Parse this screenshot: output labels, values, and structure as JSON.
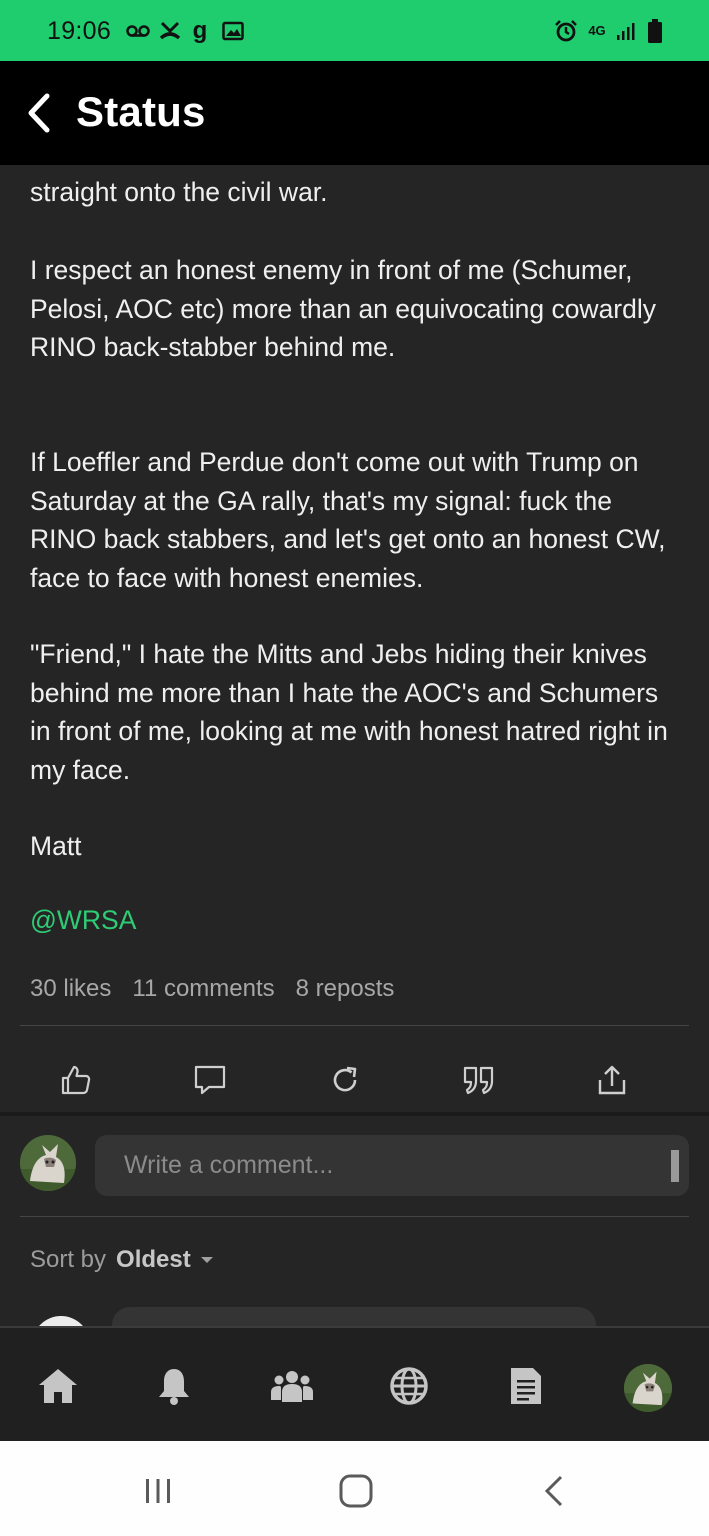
{
  "status_bar": {
    "time": "19:06",
    "notification_icons": [
      "voicemail-icon",
      "missed-call-icon",
      "g-app-icon",
      "gallery-icon"
    ],
    "system_icons": [
      "alarm-icon",
      "4g-lte-icon",
      "signal-icon",
      "battery-icon"
    ],
    "network": "4G"
  },
  "header": {
    "title": "Status"
  },
  "post": {
    "paragraphs": [
      "straight onto the civil war.",
      "I respect an honest enemy in front of me (Schumer, Pelosi, AOC etc) more than an equivocating cowardly RINO back-stabber behind me.",
      "If Loeffler and Perdue don't come out with Trump on Saturday at the GA rally, that's my signal: fuck the RINO back stabbers, and let's get onto an honest CW, face to face with honest enemies.",
      "\"Friend,\" I hate the Mitts and Jebs hiding their knives behind me more than I hate the AOC's and Schumers in front of me, looking at me with honest hatred right in my face.",
      "Matt"
    ],
    "mention": "@WRSA",
    "stats": {
      "likes": "30 likes",
      "comments": "11 comments",
      "reposts": "8 reposts"
    },
    "actions": [
      "like-icon",
      "comment-icon",
      "repost-icon",
      "quote-icon",
      "share-icon"
    ]
  },
  "comment_input": {
    "placeholder": "Write a comment..."
  },
  "sort": {
    "label": "Sort by",
    "value": "Oldest"
  },
  "bottom_nav": [
    "home-icon",
    "bell-icon",
    "groups-icon",
    "globe-icon",
    "document-icon",
    "profile-avatar"
  ],
  "system_nav": [
    "recents-button",
    "home-button",
    "back-button"
  ],
  "colors": {
    "accent": "#1fcd6f",
    "mention": "#2fcc76",
    "background": "#252525",
    "header": "#000000"
  }
}
